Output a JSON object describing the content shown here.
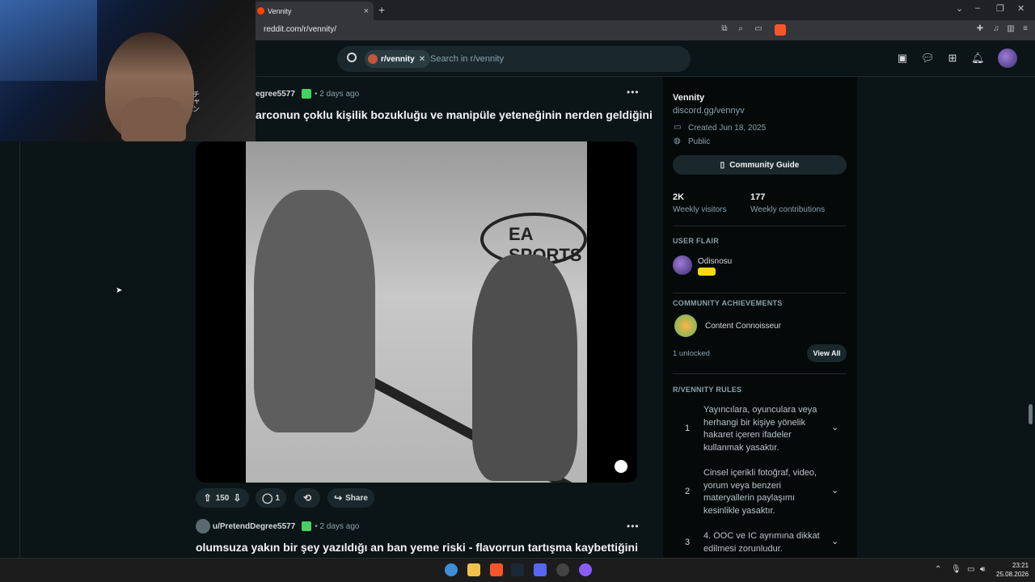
{
  "browser": {
    "tab_title": "Vennity",
    "url": "reddit.com/r/vennity/"
  },
  "header": {
    "search_chip": "r/vennity",
    "search_placeholder": "Search in r/vennity"
  },
  "webcam": {
    "kana": "チャン"
  },
  "posts": [
    {
      "author": "egree5577",
      "time": "• 2 days ago",
      "title": "arconun çoklu kişilik bozukluğu ve manipüle yeteneğinin nerden geldiğini",
      "video_logo": "EA SPORTS",
      "votes": "150",
      "comments": "1",
      "share_label": "Share"
    },
    {
      "author": "u/PretendDegree5577",
      "time": "• 2 days ago",
      "title": "olumsuza yakın bir şey yazıldığı an ban yeme riski - flavorrun tartışma kaybettiğini"
    }
  ],
  "sidebar": {
    "name": "Vennity",
    "discord": "discord.gg/vennyv",
    "created": "Created Jun 18, 2025",
    "visibility": "Public",
    "guide_button": "Community Guide",
    "stats": [
      {
        "value": "2K",
        "label": "Weekly visitors"
      },
      {
        "value": "177",
        "label": "Weekly contributions"
      }
    ],
    "user_flair_heading": "USER FLAIR",
    "flair_user": "Odisnosu",
    "achievements_heading": "COMMUNITY ACHIEVEMENTS",
    "achievement": "Content Connoisseur",
    "unlocked": "1 unlocked",
    "view_all": "View All",
    "rules_heading": "R/VENNITY RULES",
    "rules": [
      {
        "num": "1",
        "text": "Yayıncılara, oyunculara veya herhangi bir kişiye yönelik hakaret içeren ifadeler kullanmak yasaktır."
      },
      {
        "num": "2",
        "text": "Cinsel içerikli fotoğraf, video, yorum veya benzeri materyallerin paylaşımı kesinlikle yasaktır."
      },
      {
        "num": "3",
        "text": "4. OOC ve IC ayrımına dikkat edilmesi zorunludur."
      }
    ]
  },
  "taskbar": {
    "time": "23:21",
    "date": "25.08.2026"
  },
  "colors": {
    "reddit_orange": "#ff4500",
    "background": "#0b1416",
    "flair_green": "#46d160"
  }
}
